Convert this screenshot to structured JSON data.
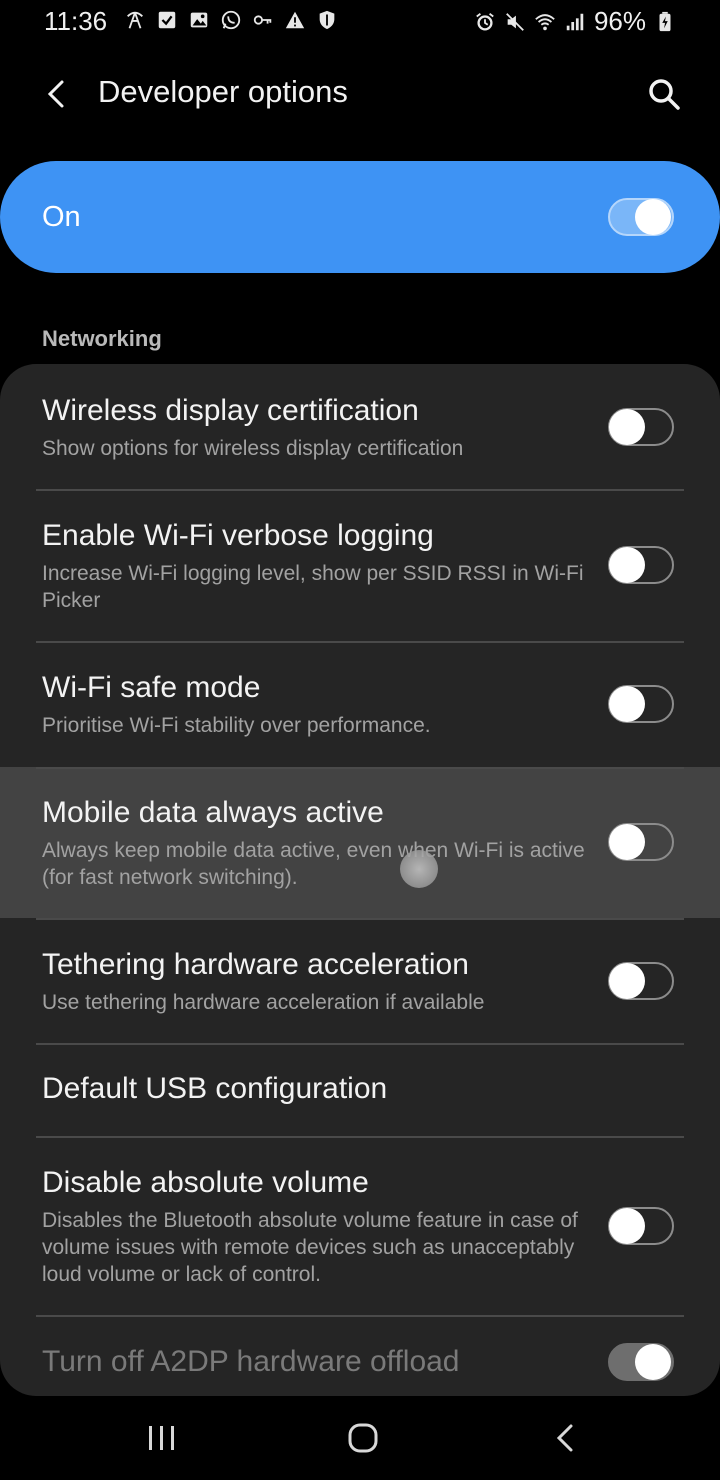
{
  "status_bar": {
    "time": "11:36",
    "battery": "96%",
    "left_icons": [
      "signal-scan-icon",
      "check-box-icon",
      "image-icon",
      "whatsapp-icon",
      "key-icon",
      "warning-icon",
      "shield-icon"
    ],
    "right_icons": [
      "alarm-icon",
      "mute-icon",
      "wifi-icon",
      "cell-signal-icon",
      "battery-charging-icon"
    ]
  },
  "app_bar": {
    "title": "Developer options",
    "back_icon": "back-arrow-icon",
    "search_icon": "search-icon"
  },
  "master_switch": {
    "label": "On",
    "state": true,
    "accent": "#3e93f4"
  },
  "section": {
    "title": "Networking"
  },
  "items": [
    {
      "title": "Wireless display certification",
      "subtitle": "Show options for wireless display certification",
      "toggle": false
    },
    {
      "title": "Enable Wi-Fi verbose logging",
      "subtitle": "Increase Wi-Fi logging level, show per SSID RSSI in Wi-Fi Picker",
      "toggle": false
    },
    {
      "title": "Wi-Fi safe mode",
      "subtitle": "Prioritise Wi-Fi stability over performance.",
      "toggle": false
    },
    {
      "title": "Mobile data always active",
      "subtitle": "Always keep mobile data active, even when Wi-Fi is active (for fast network switching).",
      "toggle": false
    },
    {
      "title": "Tethering hardware acceleration",
      "subtitle": "Use tethering hardware acceleration if available",
      "toggle": false
    },
    {
      "title": "Default USB configuration"
    },
    {
      "title": "Disable absolute volume",
      "subtitle": "Disables the Bluetooth absolute volume feature in case of volume issues with remote devices such as unacceptably loud volume or lack of control.",
      "toggle": false
    },
    {
      "title": "Turn off A2DP hardware offload",
      "toggle": true
    }
  ],
  "nav_bar": {
    "recents_icon": "recent-apps-icon",
    "home_icon": "home-icon",
    "back_icon": "nav-back-icon"
  }
}
